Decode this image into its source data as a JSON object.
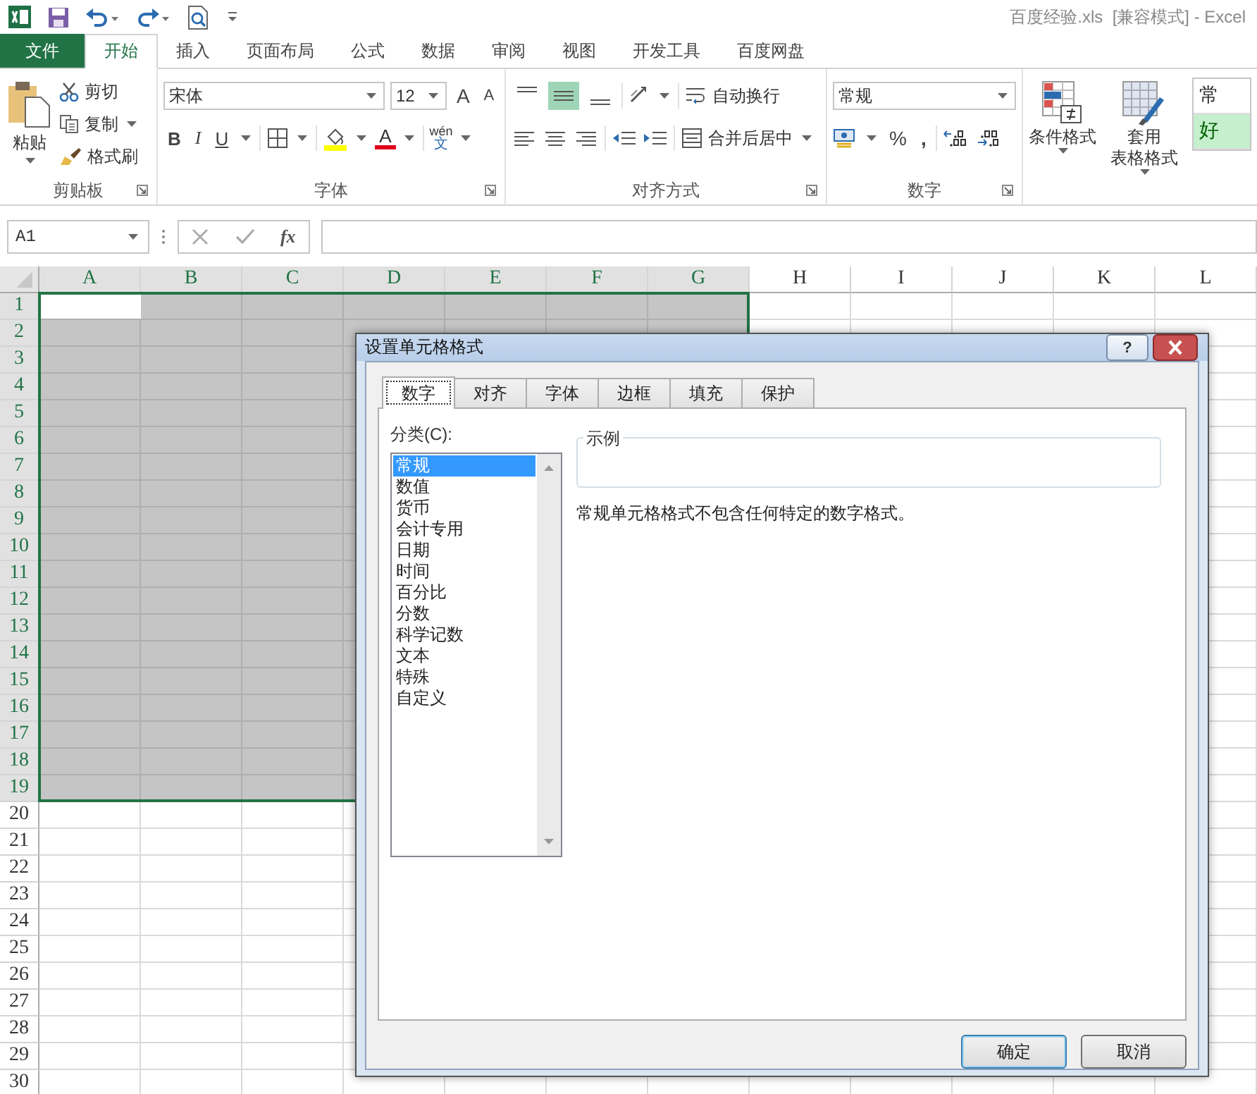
{
  "window": {
    "title": "百度经验.xls  [兼容模式] - Excel"
  },
  "ribbon_tabs": [
    {
      "label": "文件",
      "kind": "file",
      "selected": false
    },
    {
      "label": "开始",
      "kind": "tab",
      "selected": true
    },
    {
      "label": "插入",
      "kind": "tab",
      "selected": false
    },
    {
      "label": "页面布局",
      "kind": "tab",
      "selected": false
    },
    {
      "label": "公式",
      "kind": "tab",
      "selected": false
    },
    {
      "label": "数据",
      "kind": "tab",
      "selected": false
    },
    {
      "label": "审阅",
      "kind": "tab",
      "selected": false
    },
    {
      "label": "视图",
      "kind": "tab",
      "selected": false
    },
    {
      "label": "开发工具",
      "kind": "tab",
      "selected": false
    },
    {
      "label": "百度网盘",
      "kind": "tab",
      "selected": false
    }
  ],
  "clipboard": {
    "label": "剪贴板",
    "paste": "粘贴",
    "cut": "剪切",
    "copy": "复制",
    "format_painter": "格式刷"
  },
  "font": {
    "label": "字体",
    "font_name": "宋体",
    "font_size": "12",
    "grow": "A",
    "shrink": "A",
    "bold": "B",
    "italic": "I",
    "underline": "U",
    "font_color": "A",
    "phonetic_top": "wén",
    "phonetic_bottom": "文"
  },
  "alignment": {
    "label": "对齐方式",
    "vertical": [
      {
        "kind": "top",
        "selected": false
      },
      {
        "kind": "middle",
        "selected": true
      },
      {
        "kind": "bottom",
        "selected": false
      }
    ],
    "wrap_text": "自动换行",
    "merge_center": "合并后居中"
  },
  "number": {
    "label": "数字",
    "format": "常规",
    "percent": "%",
    "comma": ","
  },
  "styles": {
    "conditional_format": "条件格式",
    "format_table_top": "套用",
    "format_table_bottom": "表格格式",
    "style_normal": "常",
    "style_good": "好"
  },
  "formula_bar": {
    "name_box": "A1",
    "function_label": "fx"
  },
  "sheet": {
    "columns": [
      {
        "label": "A",
        "selected": true
      },
      {
        "label": "B",
        "selected": true
      },
      {
        "label": "C",
        "selected": true
      },
      {
        "label": "D",
        "selected": true
      },
      {
        "label": "E",
        "selected": true
      },
      {
        "label": "F",
        "selected": true
      },
      {
        "label": "G",
        "selected": true
      },
      {
        "label": "H",
        "selected": false
      },
      {
        "label": "I",
        "selected": false
      },
      {
        "label": "J",
        "selected": false
      },
      {
        "label": "K",
        "selected": false
      },
      {
        "label": "L",
        "selected": false
      }
    ],
    "rows": [
      {
        "label": "1",
        "selected": true
      },
      {
        "label": "2",
        "selected": true
      },
      {
        "label": "3",
        "selected": true
      },
      {
        "label": "4",
        "selected": true
      },
      {
        "label": "5",
        "selected": true
      },
      {
        "label": "6",
        "selected": true
      },
      {
        "label": "7",
        "selected": true
      },
      {
        "label": "8",
        "selected": true
      },
      {
        "label": "9",
        "selected": true
      },
      {
        "label": "10",
        "selected": true
      },
      {
        "label": "11",
        "selected": true
      },
      {
        "label": "12",
        "selected": true
      },
      {
        "label": "13",
        "selected": true
      },
      {
        "label": "14",
        "selected": true
      },
      {
        "label": "15",
        "selected": true
      },
      {
        "label": "16",
        "selected": true
      },
      {
        "label": "17",
        "selected": true
      },
      {
        "label": "18",
        "selected": true
      },
      {
        "label": "19",
        "selected": true
      },
      {
        "label": "20",
        "selected": false
      },
      {
        "label": "21",
        "selected": false
      },
      {
        "label": "22",
        "selected": false
      },
      {
        "label": "23",
        "selected": false
      },
      {
        "label": "24",
        "selected": false
      },
      {
        "label": "25",
        "selected": false
      },
      {
        "label": "26",
        "selected": false
      },
      {
        "label": "27",
        "selected": false
      },
      {
        "label": "28",
        "selected": false
      },
      {
        "label": "29",
        "selected": false
      },
      {
        "label": "30",
        "selected": false
      }
    ]
  },
  "dialog": {
    "title": "设置单元格格式",
    "help": "?",
    "tabs": [
      {
        "label": "数字",
        "selected": true
      },
      {
        "label": "对齐",
        "selected": false
      },
      {
        "label": "字体",
        "selected": false
      },
      {
        "label": "边框",
        "selected": false
      },
      {
        "label": "填充",
        "selected": false
      },
      {
        "label": "保护",
        "selected": false
      }
    ],
    "category_label": "分类(C):",
    "categories": [
      {
        "label": "常规",
        "selected": true
      },
      {
        "label": "数值",
        "selected": false
      },
      {
        "label": "货币",
        "selected": false
      },
      {
        "label": "会计专用",
        "selected": false
      },
      {
        "label": "日期",
        "selected": false
      },
      {
        "label": "时间",
        "selected": false
      },
      {
        "label": "百分比",
        "selected": false
      },
      {
        "label": "分数",
        "selected": false
      },
      {
        "label": "科学记数",
        "selected": false
      },
      {
        "label": "文本",
        "selected": false
      },
      {
        "label": "特殊",
        "selected": false
      },
      {
        "label": "自定义",
        "selected": false
      }
    ],
    "sample_label": "示例",
    "description": "常规单元格格式不包含任何特定的数字格式。",
    "buttons": [
      {
        "label": "确定",
        "kind": "default"
      },
      {
        "label": "取消",
        "kind": "normal"
      }
    ]
  }
}
